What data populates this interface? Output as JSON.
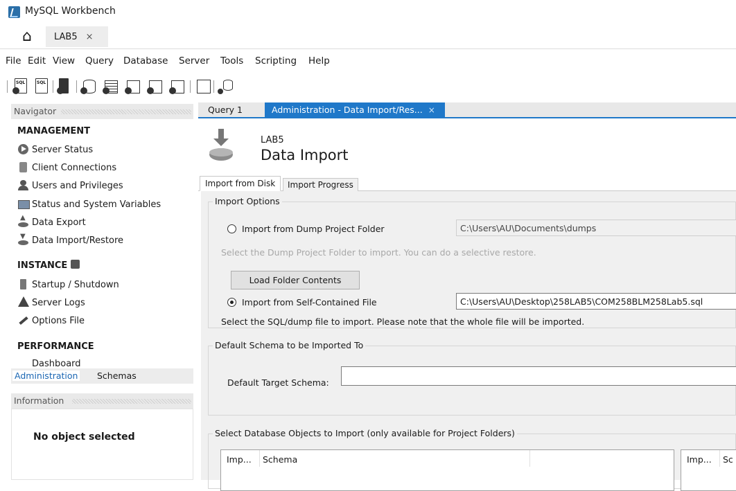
{
  "app": {
    "title": "MySQL Workbench"
  },
  "connection_tab": {
    "label": "LAB5",
    "close": "×"
  },
  "menu": [
    "File",
    "Edit",
    "View",
    "Query",
    "Database",
    "Server",
    "Tools",
    "Scripting",
    "Help"
  ],
  "toolbar": {
    "icons": [
      "new-sql-tab-icon",
      "open-sql-script-icon",
      "open-inspector-icon",
      "create-schema-icon",
      "create-table-icon",
      "create-view-icon",
      "create-procedure-icon",
      "create-function-icon",
      "search-table-data-icon",
      "reconnect-icon"
    ]
  },
  "navigator": {
    "header": "Navigator",
    "management": {
      "title": "MANAGEMENT",
      "items": [
        "Server Status",
        "Client Connections",
        "Users and Privileges",
        "Status and System Variables",
        "Data Export",
        "Data Import/Restore"
      ]
    },
    "instance": {
      "title": "INSTANCE",
      "items": [
        "Startup / Shutdown",
        "Server Logs",
        "Options File"
      ]
    },
    "performance": {
      "title": "PERFORMANCE",
      "items": [
        "Dashboard"
      ]
    },
    "tabs": [
      "Administration",
      "Schemas"
    ]
  },
  "information": {
    "header": "Information",
    "empty_text": "No object selected"
  },
  "doc_tabs": {
    "query": "Query 1",
    "admin": "Administration - Data Import/Res...",
    "close": "×"
  },
  "page": {
    "server": "LAB5",
    "title": "Data Import"
  },
  "sub_tabs": [
    "Import from Disk",
    "Import Progress"
  ],
  "import_options": {
    "legend": "Import Options",
    "dump_folder_label": "Import from Dump Project Folder",
    "dump_folder_path": "C:\\Users\\AU\\Documents\\dumps",
    "dump_folder_selected": false,
    "dump_folder_hint": "Select the Dump Project Folder to import. You can do a selective restore.",
    "load_button": "Load Folder Contents",
    "file_label": "Import from Self-Contained File",
    "file_path": "C:\\Users\\AU\\Desktop\\258LAB5\\COM258BLM258Lab5.sql",
    "file_selected": true,
    "file_hint": "Select the SQL/dump file to import. Please note that the whole file will be imported."
  },
  "default_schema": {
    "legend": "Default Schema to be Imported To",
    "label": "Default Target Schema:",
    "value": ""
  },
  "db_objects": {
    "legend": "Select Database Objects to Import (only available for Project Folders)",
    "left_columns": [
      "Imp...",
      "Schema"
    ],
    "right_columns": [
      "Imp...",
      "Sc"
    ]
  }
}
